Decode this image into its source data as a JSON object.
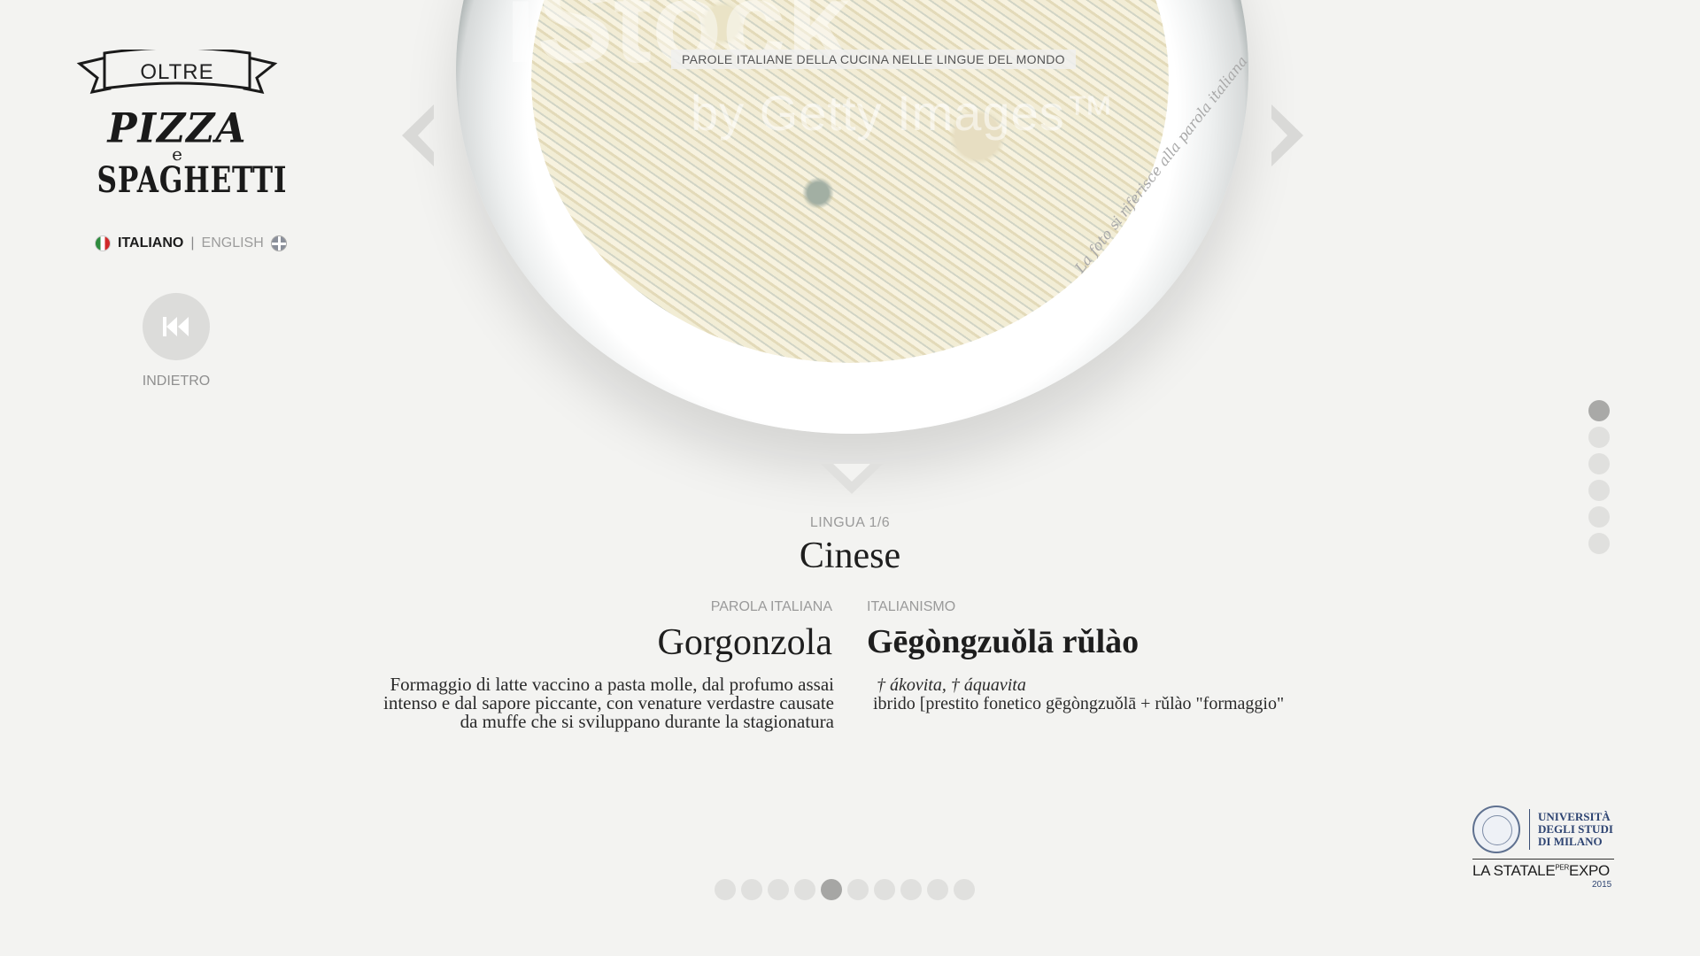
{
  "logo": {
    "oltre": "OLTRE",
    "pizza": "PIZZA",
    "e": "e",
    "spaghetti": "SPAGHETTI"
  },
  "language": {
    "italian": "ITALIANO",
    "separator": "|",
    "english": "ENGLISH"
  },
  "back": {
    "label": "INDIETRO"
  },
  "hero": {
    "banner": "PAROLE ITALIANE DELLA CUCINA NELLE LINGUE DEL MONDO",
    "photo_note": "La foto si riferisce alla parola italiana",
    "watermark": "by Getty Images™",
    "watermark_brand": "iStock"
  },
  "entry": {
    "lingua_count": "LINGUA 1/6",
    "lingua_name": "Cinese",
    "label_italian": "PAROLA ITALIANA",
    "label_italianism": "ITALIANISMO",
    "italian_word": "Gorgonzola",
    "italianism": "Gēgòngzuǒlā rǔlào",
    "definition": "Formaggio di latte vaccino a pasta molle, dal profumo assai intenso e dal sapore piccante, con venature verdastre causate da muffe che si sviluppano durante la stagionatura",
    "variants": "† ákovita, † áquavita",
    "etymology": "ibrido [prestito fonetico gēgòngzuǒlā + rǔlào \"formaggio\""
  },
  "vertical_dots": {
    "count": 6,
    "active_index": 0
  },
  "horizontal_dots": {
    "count": 10,
    "active_index": 4
  },
  "university": {
    "line1": "UNIVERSITÀ",
    "line2": "DEGLI STUDI",
    "line3": "DI MILANO",
    "statale": "LA STATALE",
    "per": "PER",
    "expo": "EXPO",
    "year": "2015"
  },
  "colors": {
    "background": "#f3f3f1",
    "dot": "#e0e0de",
    "dot_active": "#a9a9a7",
    "university_blue": "#2e4472"
  }
}
